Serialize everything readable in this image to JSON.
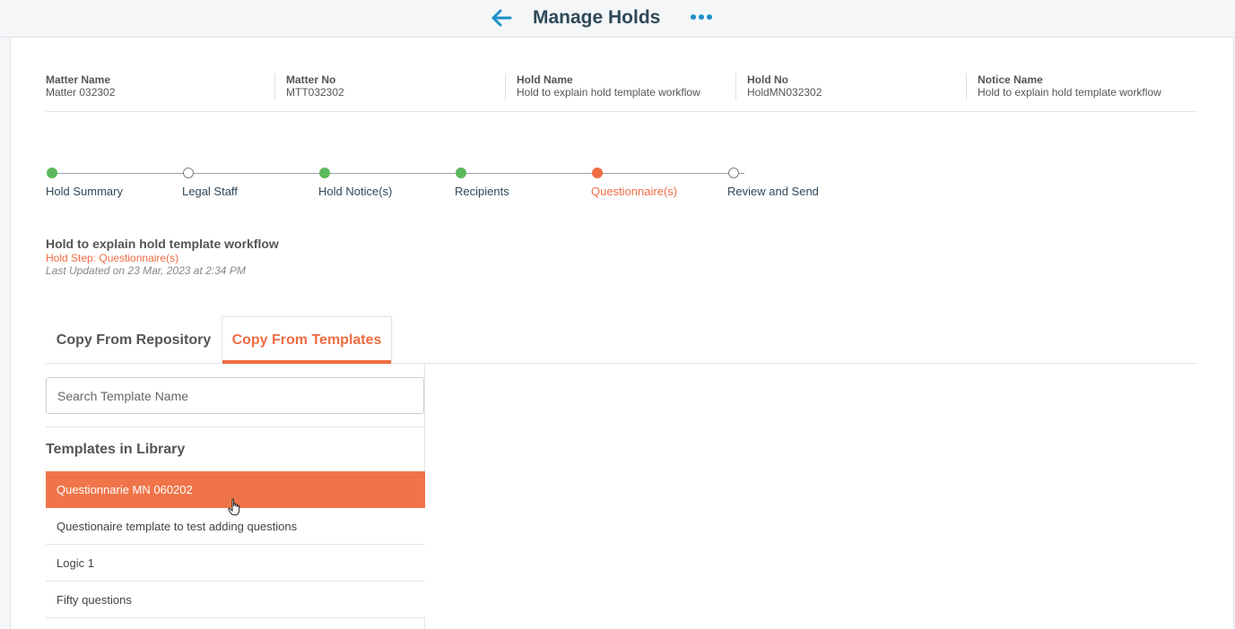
{
  "header": {
    "title": "Manage Holds",
    "back_icon": "arrow-left-icon",
    "more_icon": "ellipsis-icon",
    "accent": "#1e8fc9"
  },
  "info": [
    {
      "label": "Matter Name",
      "value": "Matter 032302"
    },
    {
      "label": "Matter No",
      "value": "MTT032302"
    },
    {
      "label": "Hold Name",
      "value": "Hold to explain hold template workflow"
    },
    {
      "label": "Hold No",
      "value": "HoldMN032302"
    },
    {
      "label": "Notice Name",
      "value": "Hold to explain hold template workflow"
    }
  ],
  "stepper": {
    "steps": [
      {
        "label": "Hold Summary",
        "state": "done"
      },
      {
        "label": "Legal Staff",
        "state": "todo"
      },
      {
        "label": "Hold Notice(s)",
        "state": "done"
      },
      {
        "label": "Recipients",
        "state": "done"
      },
      {
        "label": "Questionnaire(s)",
        "state": "active"
      },
      {
        "label": "Review and Send",
        "state": "todo"
      }
    ],
    "colors": {
      "done": "#5cb85c",
      "active": "#ef6c44"
    }
  },
  "hold": {
    "title": "Hold to explain hold template workflow",
    "step": "Hold Step: Questionnaire(s)",
    "updated": "Last Updated on 23 Mar, 2023 at 2:34 PM"
  },
  "tabs": {
    "repository": "Copy From Repository",
    "templates": "Copy From Templates",
    "active": "templates"
  },
  "search": {
    "placeholder": "Search Template Name",
    "value": ""
  },
  "library": {
    "heading": "Templates in Library",
    "items": [
      {
        "label": "Questionnarie MN 060202",
        "selected": true
      },
      {
        "label": "Questionaire template to test adding questions",
        "selected": false
      },
      {
        "label": "Logic 1",
        "selected": false
      },
      {
        "label": "Fifty questions",
        "selected": false
      }
    ],
    "selected_color": "#f07449"
  }
}
